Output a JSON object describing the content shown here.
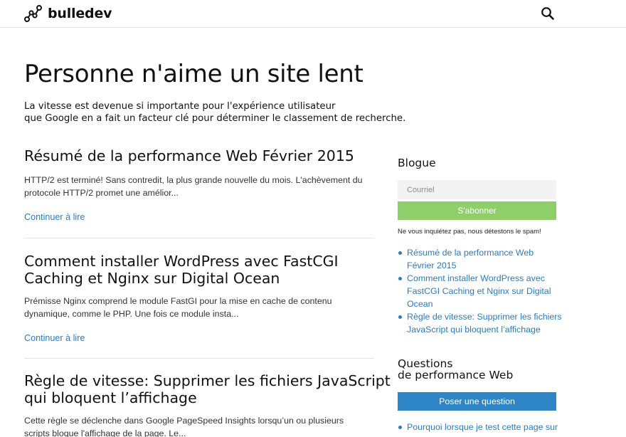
{
  "header": {
    "brand": "bulledev",
    "logo_icon": "graph-nodes-icon",
    "search_icon": "search-icon"
  },
  "hero": {
    "title": "Personne n'aime un site lent",
    "subtitle_lines": [
      "La vitesse est devenue si importante pour l'expérience utilisateur",
      "que Google en a fait un facteur clé pour déterminer le classement de recherche."
    ]
  },
  "posts": [
    {
      "title_lines": [
        "Résumé de la performance Web Février 2015"
      ],
      "excerpt_lines": [
        "HTTP/2 est terminé! Sans contredit, la plus grande nouvelle du mois. L'achèvement du",
        "protocole HTTP/2 promet une amélior..."
      ],
      "read_more": "Continuer à lire"
    },
    {
      "title_lines": [
        "Comment installer WordPress avec FastCGI",
        "Caching et Nginx sur Digital Ocean"
      ],
      "excerpt_lines": [
        "Prémisse Nginx comprend le module FastGI pour la mise en cache de contenu",
        "dynamique, comme le PHP. Une fois ce module insta..."
      ],
      "read_more": "Continuer à lire"
    },
    {
      "title_lines": [
        "Règle de vitesse: Supprimer les fichiers JavaScript",
        "qui bloquent l’affichage"
      ],
      "excerpt_lines": [
        "Cette règle se déclenche dans Google PageSpeed Insights lorsqu’un ou plusieurs",
        "scripts bloque l'affichage de la page. Le..."
      ]
    }
  ],
  "sidebar": {
    "blog_heading": "Blogue",
    "email_placeholder": "Courriel",
    "subscribe_label": "S'abonner",
    "nospam": "Ne vous inquiétez pas, nous détestons le spam!",
    "blog_links": [
      {
        "lines": [
          "Résumé de la performance Web",
          "Février 2015"
        ]
      },
      {
        "lines": [
          "Comment installer WordPress avec",
          "FastCGI Caching et Nginx sur Digital",
          "Ocean"
        ]
      },
      {
        "lines": [
          "Règle de vitesse: Supprimer les fichiers",
          "JavaScript qui bloquent l’affichage"
        ]
      }
    ],
    "questions_heading_lines": [
      "Questions",
      "de performance Web"
    ],
    "ask_label": "Poser une question",
    "question_links": [
      {
        "lines": [
          "Pourquoi lorsque je test cette page sur"
        ]
      }
    ]
  },
  "colors": {
    "link": "#2a7bbf",
    "subscribe": "#8fcf6b",
    "ask": "#2f86c6"
  }
}
